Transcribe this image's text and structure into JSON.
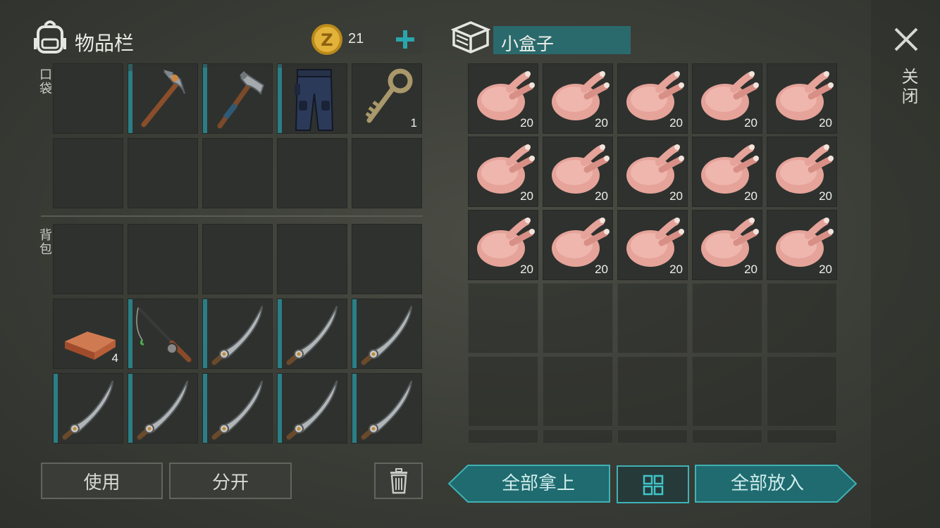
{
  "inventory": {
    "title": "物品栏",
    "coins": "21",
    "pockets_label": "口袋",
    "backpack_label": "背包",
    "pocket_slots": [
      {
        "item": "",
        "icon": ""
      },
      {
        "item": "pickaxe",
        "icon": "pickaxe-icon",
        "durability": 0.9
      },
      {
        "item": "hatchet",
        "icon": "hatchet-icon",
        "durability": 0.95
      },
      {
        "item": "pants",
        "icon": "pants-icon",
        "durability": 0.95
      },
      {
        "item": "key",
        "icon": "key-icon",
        "count": "1"
      },
      {
        "item": "",
        "icon": ""
      },
      {
        "item": "",
        "icon": ""
      },
      {
        "item": "",
        "icon": ""
      },
      {
        "item": "",
        "icon": ""
      },
      {
        "item": "",
        "icon": ""
      }
    ],
    "backpack_slots": [
      {
        "item": "",
        "icon": ""
      },
      {
        "item": "",
        "icon": ""
      },
      {
        "item": "",
        "icon": ""
      },
      {
        "item": "",
        "icon": ""
      },
      {
        "item": "",
        "icon": ""
      },
      {
        "item": "copper-bar",
        "icon": "copper-bar-icon",
        "count": "4"
      },
      {
        "item": "fishing-rod",
        "icon": "fishing-rod-icon",
        "durability": 1.0
      },
      {
        "item": "machete",
        "icon": "machete-icon",
        "durability": 1.0
      },
      {
        "item": "machete",
        "icon": "machete-icon",
        "durability": 1.0
      },
      {
        "item": "machete",
        "icon": "machete-icon",
        "durability": 1.0
      },
      {
        "item": "machete",
        "icon": "machete-icon",
        "durability": 1.0
      },
      {
        "item": "machete",
        "icon": "machete-icon",
        "durability": 1.0
      },
      {
        "item": "machete",
        "icon": "machete-icon",
        "durability": 1.0
      },
      {
        "item": "machete",
        "icon": "machete-icon",
        "durability": 1.0
      },
      {
        "item": "machete",
        "icon": "machete-icon",
        "durability": 1.0
      }
    ],
    "use_label": "使用",
    "split_label": "分开"
  },
  "box": {
    "title": "小盒子",
    "chicken_count": "20",
    "take_all_label": "全部拿上",
    "put_all_label": "全部放入"
  },
  "close_label": "关闭",
  "colors": {
    "accent": "#2a7f86",
    "button_teal": "#1f6b70",
    "button_border": "#3fb2b5"
  }
}
